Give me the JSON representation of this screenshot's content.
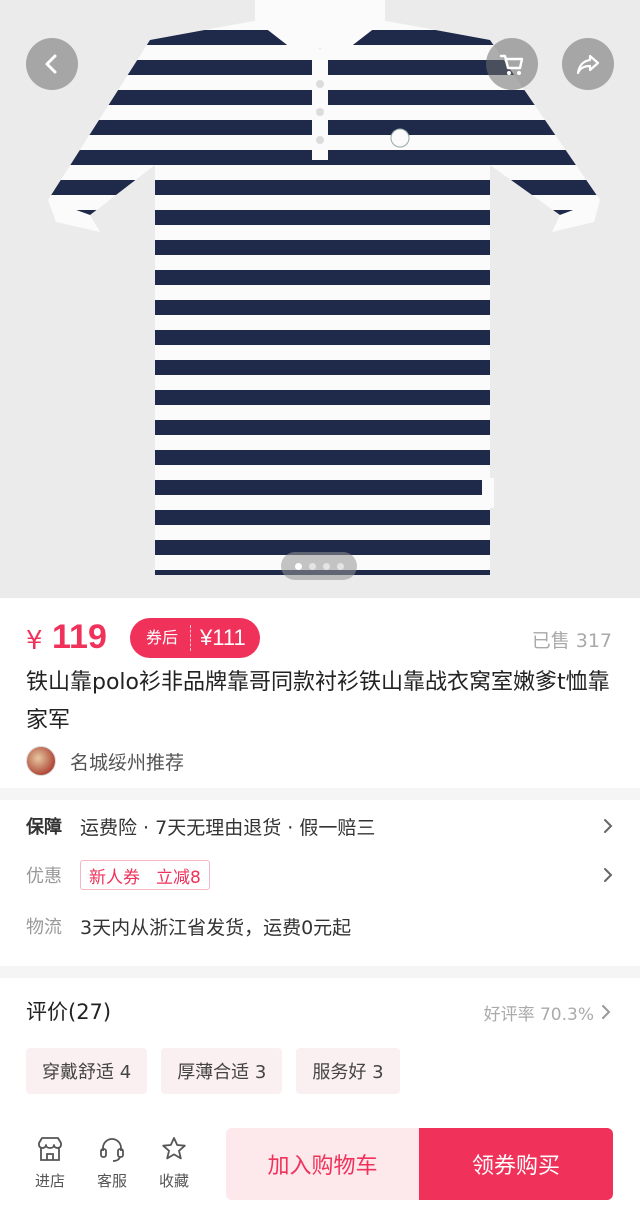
{
  "hero": {
    "icons": {
      "back": "chevron-left-icon",
      "cart": "shopping-cart-icon",
      "share": "share-arrow-icon"
    },
    "carousel": {
      "total": 4,
      "active": 1
    }
  },
  "price": {
    "symbol": "¥",
    "value": "119",
    "coupon_label": "券后",
    "coupon_price": "¥111",
    "sold": "已售 317"
  },
  "product": {
    "title": "铁山靠polo衫非品牌靠哥同款衬衫铁山靠战衣窝室嫩爹t恤靠家军"
  },
  "shop": {
    "name": "名城绥州推荐"
  },
  "service": {
    "guarantee_label": "保障",
    "guarantee_text": "运费险 · 7天无理由退货 · 假一赔三",
    "promo_label": "优惠",
    "promo_tag1": "新人券",
    "promo_tag2": "立减8",
    "shipping_label": "物流",
    "shipping_text": "3天内从浙江省发货，运费0元起"
  },
  "reviews": {
    "title": "评价(27)",
    "rate": "好评率 70.3%",
    "tags": [
      "穿戴舒适 4",
      "厚薄合适 3",
      "服务好 3"
    ]
  },
  "bottom_bar": {
    "store": "进店",
    "service": "客服",
    "favorite": "收藏",
    "add_to_cart": "加入购物车",
    "buy": "领券购买"
  },
  "colors": {
    "accent": "#f0325a",
    "stripe": "#1f2a4a"
  }
}
